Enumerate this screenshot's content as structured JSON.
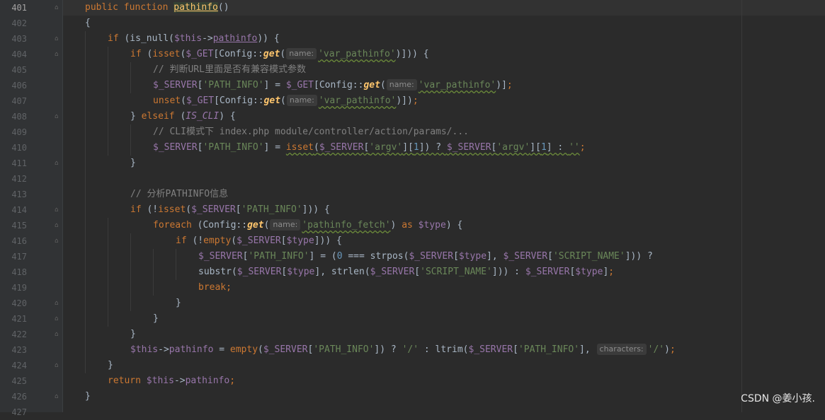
{
  "line_numbers": [
    "401",
    "402",
    "403",
    "404",
    "405",
    "406",
    "407",
    "408",
    "409",
    "410",
    "411",
    "412",
    "413",
    "414",
    "415",
    "416",
    "417",
    "418",
    "419",
    "420",
    "421",
    "422",
    "423",
    "424",
    "425",
    "426",
    "427"
  ],
  "code": {
    "l401": {
      "kw1": "public",
      "kw2": "function",
      "name": "pathinfo",
      "paren": "()"
    },
    "l402": {
      "brace": "{"
    },
    "l403": {
      "if": "if",
      "open": " (is_null(",
      "this": "$this",
      "arrow": "->",
      "prop": "pathinfo",
      "close": ")) {"
    },
    "l404": {
      "if": "if",
      "open": " (",
      "isset": "isset",
      "p1": "(",
      "get": "$_GET",
      "p2": "[Config::",
      "method": "get",
      "p3": "(",
      "hint": "name:",
      "str": "'var_pathinfo'",
      "close": ")])) {"
    },
    "l405": {
      "comment": "// 判断URL里面是否有兼容模式参数"
    },
    "l406": {
      "server": "$_SERVER",
      "b1": "[",
      "key": "'PATH_INFO'",
      "b2": "] = ",
      "get": "$_GET",
      "p2": "[Config::",
      "method": "get",
      "p3": "(",
      "hint": "name:",
      "str": "'var_pathinfo'",
      "close": ")]",
      "semi": ";"
    },
    "l407": {
      "unset": "unset",
      "p1": "(",
      "get": "$_GET",
      "p2": "[Config::",
      "method": "get",
      "p3": "(",
      "hint": "name:",
      "str": "'var_pathinfo'",
      "close": ")])",
      "semi": ";"
    },
    "l408": {
      "close": "} ",
      "elseif": "elseif",
      "open": " (",
      "const": "IS_CLI",
      "end": ") {"
    },
    "l409": {
      "comment": "// CLI模式下 index.php module/controller/action/params/..."
    },
    "l410": {
      "server": "$_SERVER",
      "b1": "[",
      "key": "'PATH_INFO'",
      "b2": "] = ",
      "isset": "isset",
      "p1": "(",
      "server2": "$_SERVER",
      "b3": "[",
      "argv": "'argv'",
      "b4": "][",
      "one": "1",
      "b5": "]) ? ",
      "server3": "$_SERVER",
      "b6": "[",
      "argv2": "'argv'",
      "b7": "][",
      "one2": "1",
      "b8": "] : ",
      "empty": "''",
      "semi": ";"
    },
    "l411": {
      "brace": "}"
    },
    "l413": {
      "comment": "// 分析PATHINFO信息"
    },
    "l414": {
      "if": "if",
      "open": " (!",
      "isset": "isset",
      "p1": "(",
      "server": "$_SERVER",
      "b1": "[",
      "key": "'PATH_INFO'",
      "close": "])) {"
    },
    "l415": {
      "foreach": "foreach",
      "open": " (Config::",
      "method": "get",
      "p3": "(",
      "hint": "name:",
      "str": "'pathinfo_fetch'",
      "p4": ") ",
      "as": "as",
      "sp": " ",
      "type": "$type",
      "close": ") {"
    },
    "l416": {
      "if": "if",
      "open": " (!",
      "empty": "empty",
      "p1": "(",
      "server": "$_SERVER",
      "b1": "[",
      "type": "$type",
      "close": "])) {"
    },
    "l417": {
      "server": "$_SERVER",
      "b1": "[",
      "key": "'PATH_INFO'",
      "b2": "] = (",
      "zero": "0",
      "mid": " === strpos(",
      "server2": "$_SERVER",
      "b3": "[",
      "type": "$type",
      "b4": "], ",
      "server3": "$_SERVER",
      "b5": "[",
      "key2": "'SCRIPT_NAME'",
      "close": "])) ?"
    },
    "l418": {
      "substr": "substr(",
      "server": "$_SERVER",
      "b1": "[",
      "type": "$type",
      "b2": "], strlen(",
      "server2": "$_SERVER",
      "b3": "[",
      "key": "'SCRIPT_NAME'",
      "b4": "])) : ",
      "server3": "$_SERVER",
      "b5": "[",
      "type2": "$type",
      "close": "]",
      "semi": ";"
    },
    "l419": {
      "break": "break",
      "semi": ";"
    },
    "l420": {
      "brace": "}"
    },
    "l421": {
      "brace": "}"
    },
    "l422": {
      "brace": "}"
    },
    "l423": {
      "this": "$this",
      "arrow": "->",
      "prop": "pathinfo",
      "eq": " = ",
      "empty": "empty",
      "p1": "(",
      "server": "$_SERVER",
      "b1": "[",
      "key": "'PATH_INFO'",
      "mid": "]) ? ",
      "slash": "'/'",
      "colon": " : ",
      "ltrim": "ltrim(",
      "server2": "$_SERVER",
      "b2": "[",
      "key2": "'PATH_INFO'",
      "b3": "], ",
      "hint": "characters:",
      "slash2": "'/'",
      "close": ")",
      "semi": ";"
    },
    "l424": {
      "brace": "}"
    },
    "l425": {
      "return": "return",
      "sp": " ",
      "this": "$this",
      "arrow": "->",
      "prop": "pathinfo",
      "semi": ";"
    },
    "l426": {
      "brace": "}"
    }
  },
  "watermark": "CSDN @姜小孩.",
  "colors": {
    "background": "#2b2b2b",
    "keyword": "#cc7832",
    "function": "#ffc66d",
    "variable": "#9876aa",
    "string": "#6a8759",
    "comment": "#808080",
    "number": "#6897bb"
  }
}
